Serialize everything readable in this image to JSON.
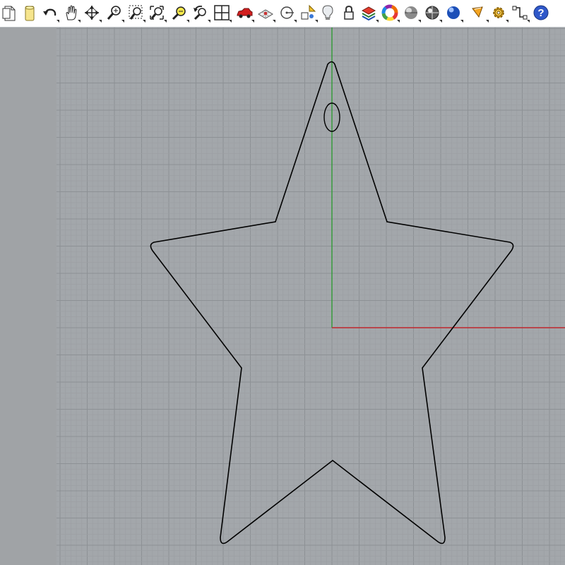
{
  "toolbar": {
    "tools": [
      {
        "name": "new-file",
        "icon": "new-document-icon"
      },
      {
        "name": "open-file",
        "icon": "open-document-icon"
      },
      {
        "name": "undo",
        "icon": "undo-arrow-icon"
      },
      {
        "name": "pan",
        "icon": "hand-pan-icon"
      },
      {
        "name": "rotate",
        "icon": "rotate-view-icon"
      },
      {
        "name": "zoom-dynamic",
        "icon": "zoom-dynamic-icon"
      },
      {
        "name": "zoom-window",
        "icon": "zoom-window-icon"
      },
      {
        "name": "zoom-extents",
        "icon": "zoom-extents-icon"
      },
      {
        "name": "zoom-selected",
        "icon": "zoom-selected-icon"
      },
      {
        "name": "undo-view",
        "icon": "undo-view-icon"
      },
      {
        "name": "four-viewports",
        "icon": "four-viewports-icon"
      },
      {
        "name": "named-views",
        "icon": "car-icon"
      },
      {
        "name": "construction-plane",
        "icon": "grid-plane-icon"
      },
      {
        "name": "cplane-origin",
        "icon": "cplane-origin-icon"
      },
      {
        "name": "select-objects",
        "icon": "select-shapes-icon"
      },
      {
        "name": "lights",
        "icon": "light-bulb-icon"
      },
      {
        "name": "lock",
        "icon": "lock-icon"
      },
      {
        "name": "layers",
        "icon": "layers-icon"
      },
      {
        "name": "object-properties",
        "icon": "color-wheel-icon"
      },
      {
        "name": "shaded-view",
        "icon": "shaded-sphere-icon"
      },
      {
        "name": "rendered-view",
        "icon": "rendered-sphere-icon"
      },
      {
        "name": "render",
        "icon": "blue-sphere-icon"
      },
      {
        "name": "render-settings",
        "icon": "render-settings-icon"
      },
      {
        "name": "options",
        "icon": "gear-icon"
      },
      {
        "name": "grasshopper",
        "icon": "connector-icon"
      },
      {
        "name": "help",
        "icon": "help-icon"
      }
    ]
  },
  "colors": {
    "viewport_background": "#a3a7ab",
    "grid_minor": "#9c9fa3",
    "grid_major": "#8d9195",
    "x_axis": "#c0272d",
    "y_axis": "#2f9a35",
    "curve": "#000000"
  }
}
